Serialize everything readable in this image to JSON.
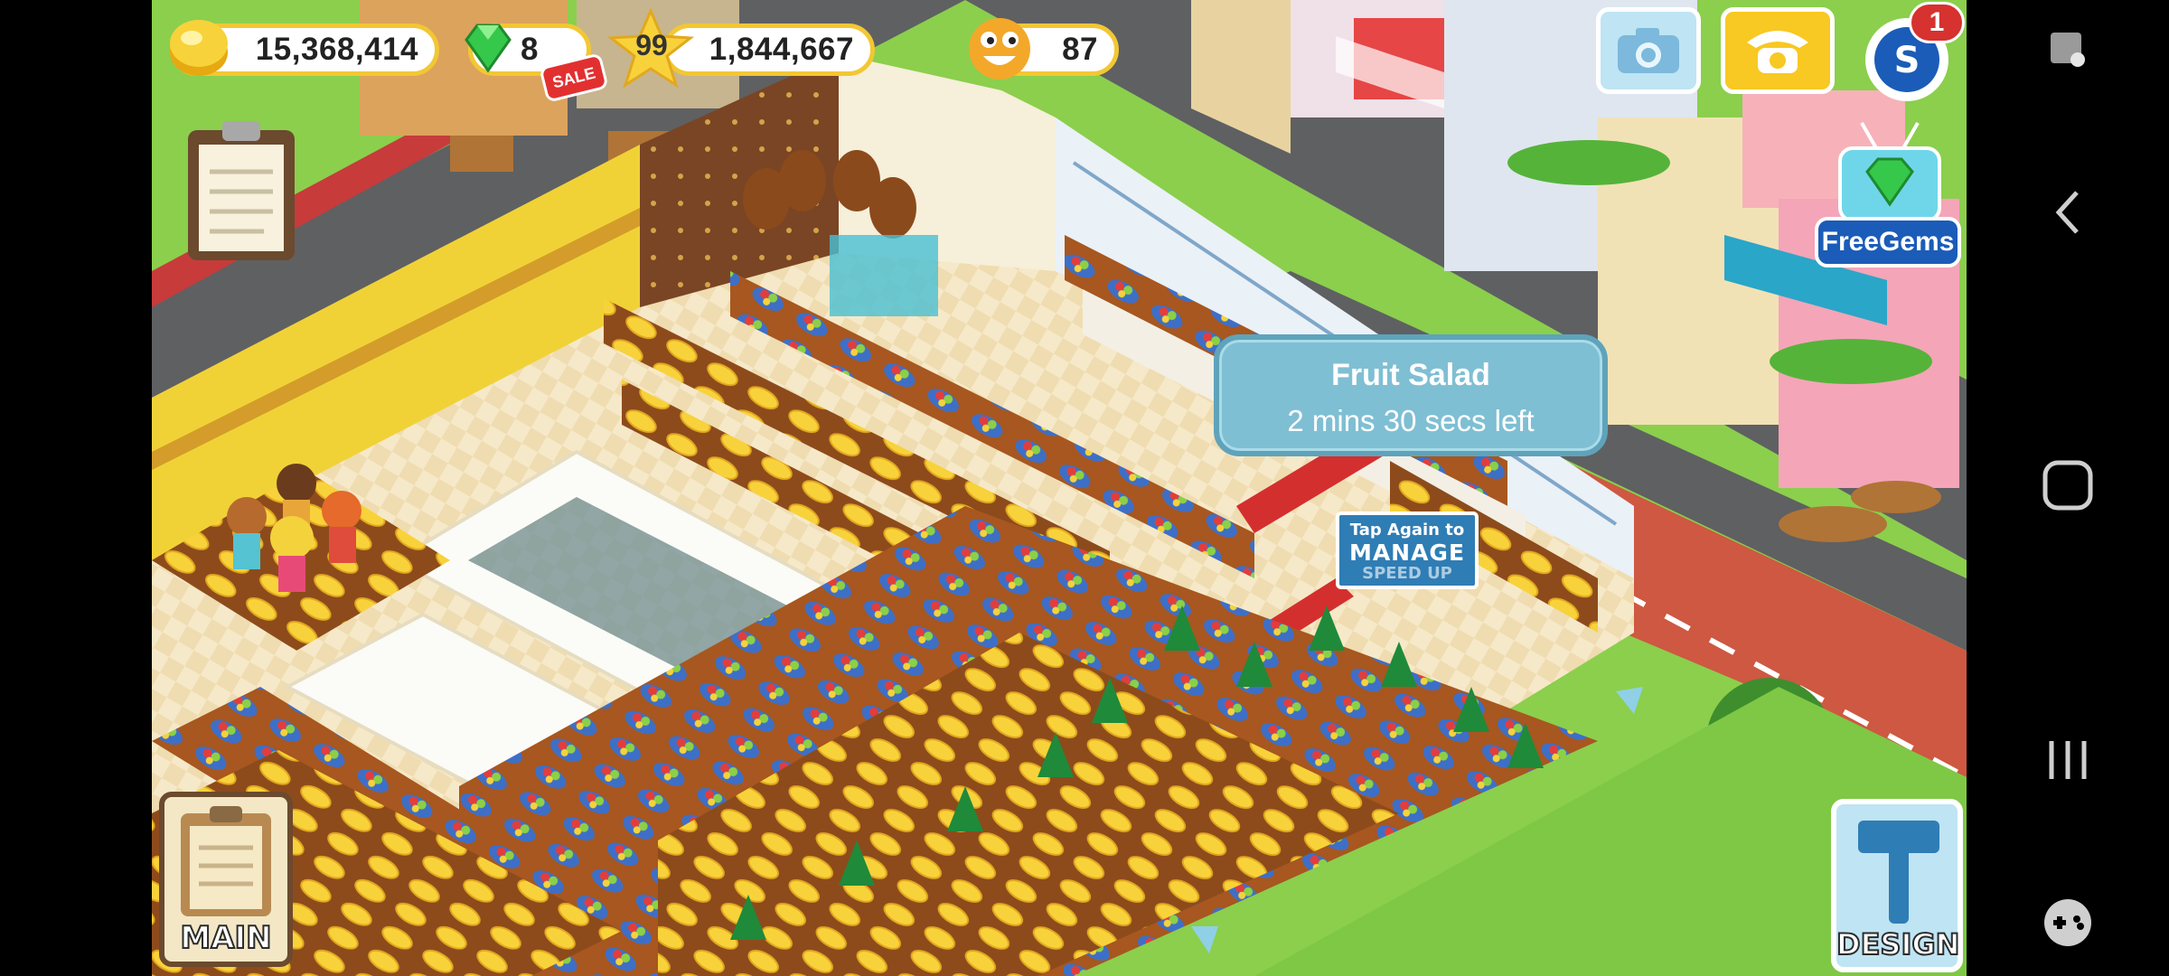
{
  "hud": {
    "coins": "15,368,414",
    "gems": "8",
    "sale_badge": "SALE",
    "level": "99",
    "experience": "1,844,667",
    "happiness": "87",
    "notification_count": "1"
  },
  "freegems": {
    "label": "FreeGems"
  },
  "tooltip": {
    "title": "Fruit Salad",
    "subtitle": "2 mins 30 secs left"
  },
  "tap_hint": {
    "line1": "Tap Again to",
    "line2": "MANAGE",
    "line3": "SPEED UP"
  },
  "buttons": {
    "main": "MAIN",
    "design": "DESIGN"
  },
  "icons": {
    "coin": "coin-icon",
    "gem": "gem-icon",
    "star": "star-icon",
    "smiley": "smiley-icon",
    "camera": "camera-icon",
    "phone": "phone-icon",
    "social": "social-icon",
    "clipboard": "clipboard-icon",
    "hammer": "hammer-icon"
  },
  "colors": {
    "hud_border": "#f2c733",
    "grass": "#7ec845",
    "road": "#5f6062",
    "tooltip_bg": "#7fbfd3",
    "freegems_bg": "#1b5cb8",
    "floor": "#f5e7c7",
    "carpet": "#d42f2f"
  }
}
